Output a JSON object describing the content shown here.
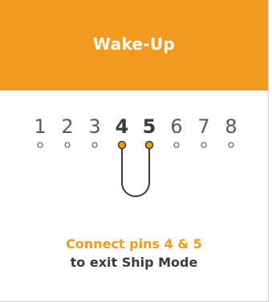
{
  "header": {
    "title": "Wake-Up"
  },
  "pins": [
    {
      "label": "1",
      "active": false
    },
    {
      "label": "2",
      "active": false
    },
    {
      "label": "3",
      "active": false
    },
    {
      "label": "4",
      "active": true
    },
    {
      "label": "5",
      "active": true
    },
    {
      "label": "6",
      "active": false
    },
    {
      "label": "7",
      "active": false
    },
    {
      "label": "8",
      "active": false
    }
  ],
  "caption": {
    "line1": "Connect pins 4 & 5",
    "line2": "to exit Ship Mode"
  },
  "colors": {
    "accent": "#f29a20",
    "text_dark": "#3a3a3a",
    "text_muted": "#5a5a5a",
    "pin_outline": "#6a6a6a"
  }
}
